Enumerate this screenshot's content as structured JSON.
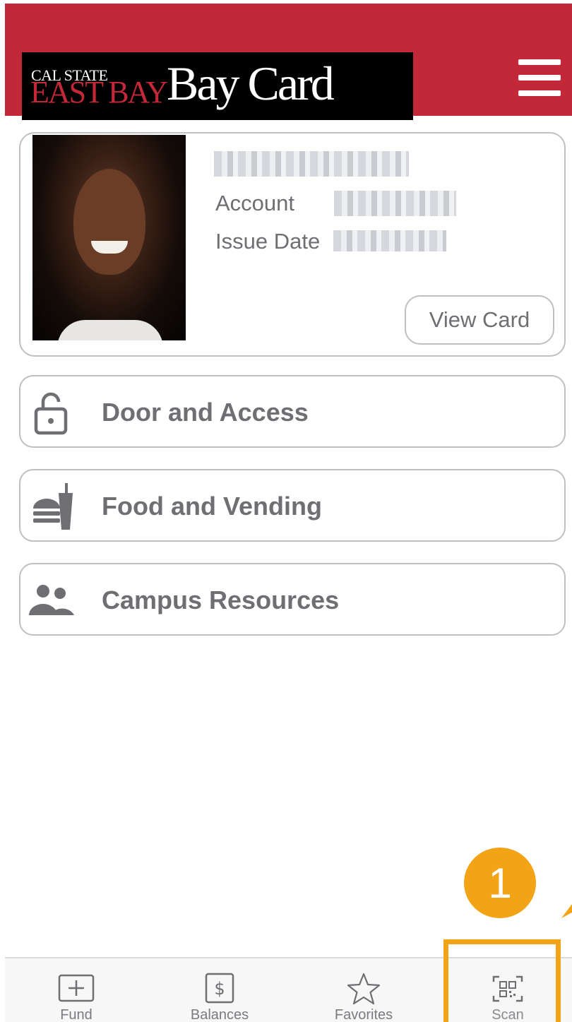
{
  "header": {
    "logo_line1": "CAL STATE",
    "logo_line2": "EAST BAY",
    "logo_product": "Bay Card",
    "brand_color": "#c32838",
    "menu_icon": "hamburger-menu-icon"
  },
  "card": {
    "account_label": "Account",
    "issue_date_label": "Issue Date",
    "view_card_label": "View Card"
  },
  "menu": {
    "items": [
      {
        "label": "Door and Access",
        "icon": "lock-icon"
      },
      {
        "label": "Food and Vending",
        "icon": "food-icon"
      },
      {
        "label": "Campus Resources",
        "icon": "people-icon"
      }
    ]
  },
  "annotation": {
    "step_number": "1",
    "color": "#f2a316"
  },
  "tabs": [
    {
      "label": "Fund",
      "icon": "plus-square-icon"
    },
    {
      "label": "Balances",
      "icon": "dollar-square-icon"
    },
    {
      "label": "Favorites",
      "icon": "star-icon"
    },
    {
      "label": "Scan",
      "icon": "qr-scan-icon"
    }
  ]
}
